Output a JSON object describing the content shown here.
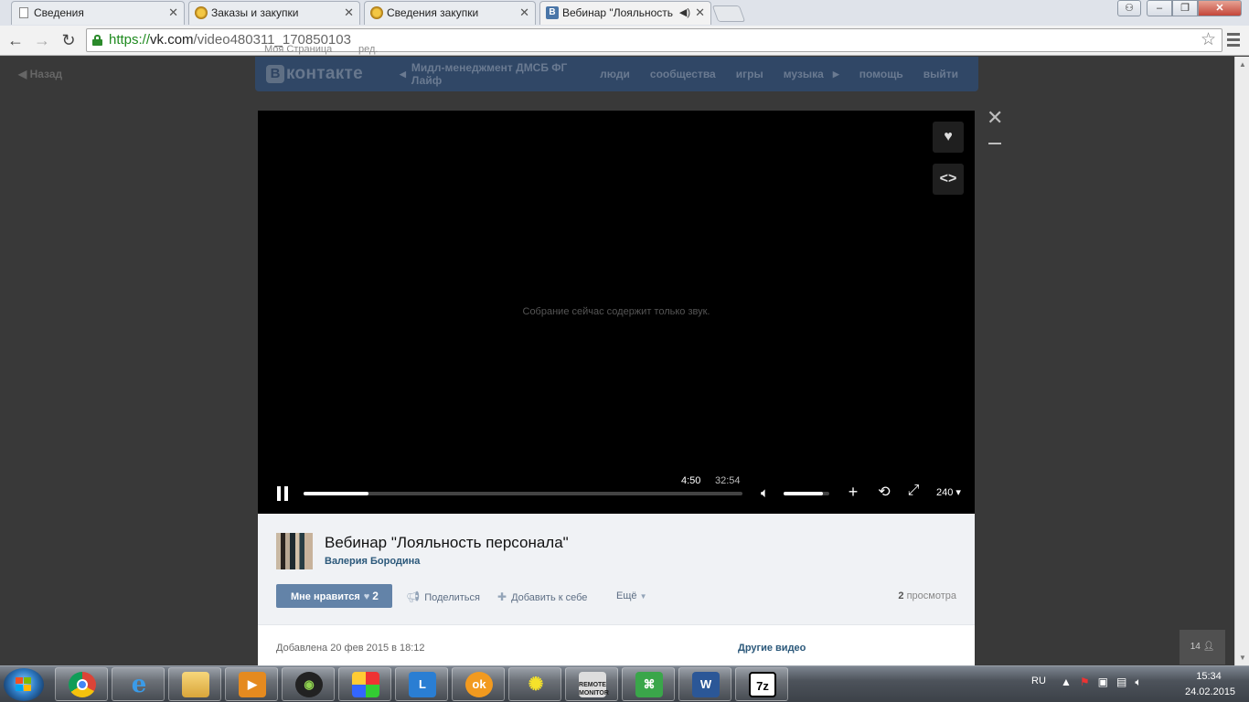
{
  "browser": {
    "tabs": [
      {
        "title": "Сведения",
        "favicon": "page-icon"
      },
      {
        "title": "Заказы и закупки",
        "favicon": "emblem-icon"
      },
      {
        "title": "Сведения закупки",
        "favicon": "emblem-icon"
      },
      {
        "title": "Вебинар \"Лояльность",
        "favicon": "vk-icon",
        "audio": true
      }
    ],
    "url_scheme": "https://",
    "url_host": "vk.com",
    "url_path": "/video480311_170850103"
  },
  "page": {
    "back_label": "Назад",
    "logo_text": "контакте",
    "logo_letter": "В",
    "nav": {
      "group": "Мидл-менеджмент ДМСБ ФГ Лайф",
      "people": "люди",
      "communities": "сообщества",
      "games": "игры",
      "music": "музыка",
      "help": "помощь",
      "logout": "выйти"
    },
    "left_menu_item": "Моя Страница",
    "left_menu_edit": "ред."
  },
  "player": {
    "message": "Собрание сейчас содержит только звук.",
    "current_time": "4:50",
    "duration": "32:54",
    "progress_fraction": 0.147,
    "volume_fraction": 0.85,
    "quality": "240"
  },
  "video": {
    "title": "Вебинар \"Лояльность персонала\"",
    "author": "Валерия Бородина",
    "like_label": "Мне нравится",
    "like_count": "2",
    "share_label": "Поделиться",
    "add_label": "Добавить к себе",
    "more_label": "Ещё",
    "views_count": "2",
    "views_label": "просмотра",
    "added_text": "Добавлена 20 фев 2015 в 18:12",
    "other_videos_label": "Другие видео"
  },
  "online_count": "14",
  "taskbar": {
    "apps": [
      "chrome-icon",
      "ie-icon",
      "explorer-icon",
      "media-player-icon",
      "webcam-icon",
      "puzzle-icon",
      "lync-icon",
      "odnoklassniki-icon",
      "sun-icon",
      "remote-monitor-icon",
      "network-icon",
      "word-icon",
      "7zip-icon"
    ],
    "remote_monitor_label": "REMOTE MONITOR",
    "word_letter": "W",
    "zip_label": "7z",
    "lang": "RU",
    "time": "15:34",
    "date": "24.02.2015"
  },
  "colors": {
    "vk_blue": "#4a76a8",
    "vk_header": "#304766",
    "like_button": "#6383a8",
    "link": "#2b587a",
    "url_green": "#1f8a1f"
  }
}
